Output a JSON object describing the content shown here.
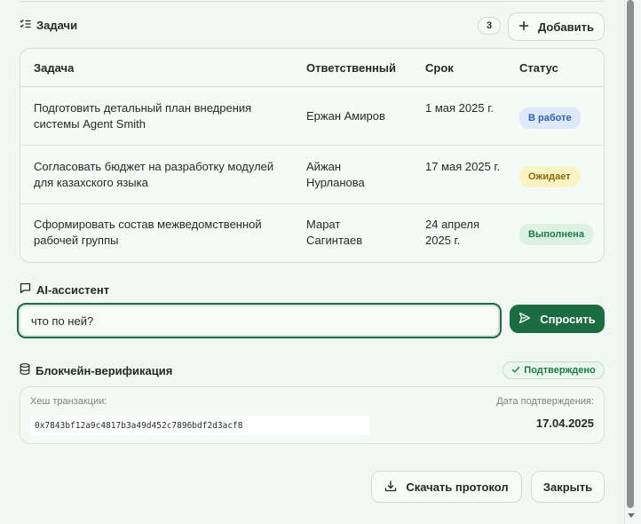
{
  "tasks": {
    "title": "Задачи",
    "count": "3",
    "add_label": "Добавить",
    "columns": [
      "Задача",
      "Ответственный",
      "Срок",
      "Статус"
    ],
    "rows": [
      {
        "task": "Подготовить детальный план внедрения системы Agent Smith",
        "owner": "Ержан Амиров",
        "due": "1 мая 2025 г.",
        "status": "В работе"
      },
      {
        "task": "Согласовать бюджет на разработку модулей для казахского языка",
        "owner": "Айжан Нурланова",
        "due": "17 мая 2025 г.",
        "status": "Ожидает"
      },
      {
        "task": "Сформировать состав межведомственной рабочей группы",
        "owner": "Марат Сагинтаев",
        "due": "24 апреля 2025 г.",
        "status": "Выполнена"
      }
    ]
  },
  "status_colors": {
    "in_progress": {
      "bg": "#dde9fb",
      "fg": "#2f5fb3"
    },
    "waiting": {
      "bg": "#fbf3c4",
      "fg": "#8a6a08"
    },
    "done": {
      "bg": "#dcf2e3",
      "fg": "#1e7b45"
    }
  },
  "ai": {
    "title": "AI-ассистент",
    "input_value": "что по ней?",
    "ask_label": "Спросить"
  },
  "blockchain": {
    "title": "Блокчейн-верификация",
    "badge": "Подтверждено",
    "hash_label": "Хеш транзакции:",
    "hash": "0x7843bf12a9c4817b3a49d452c7896bdf2d3acf8",
    "date_label": "Дата подтверждения:",
    "date": "17.04.2025"
  },
  "footer": {
    "download_label": "Скачать протокол",
    "close_label": "Закрыть"
  },
  "icons": [
    "checklist-icon",
    "plus-icon",
    "chat-icon",
    "send-icon",
    "database-icon",
    "check-icon",
    "download-icon"
  ],
  "accent": "#1b6c40"
}
